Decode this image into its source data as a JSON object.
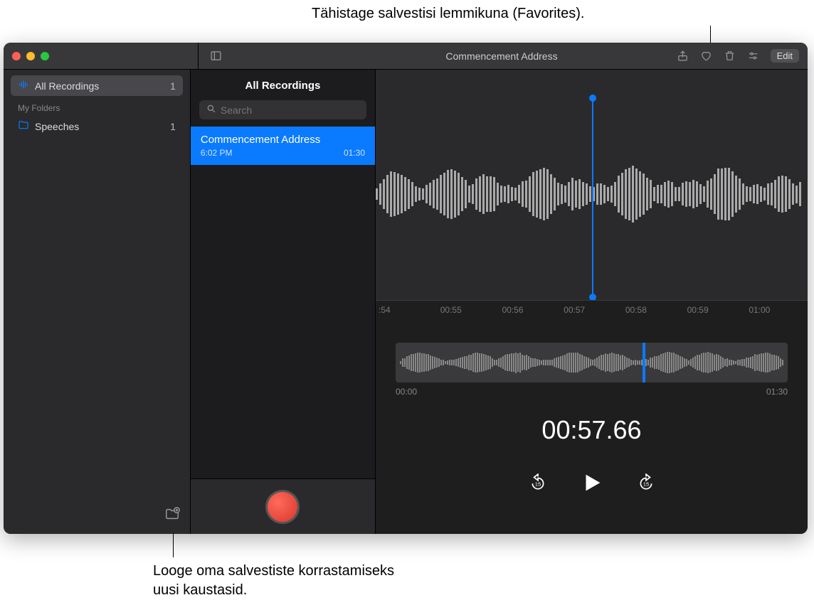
{
  "callouts": {
    "top": "Tähistage salvestisi lemmikuna (Favorites).",
    "bottom": "Looge oma salvestiste korrastamiseks\nuusi kaustasid."
  },
  "titlebar": {
    "title": "Commencement Address",
    "edit": "Edit"
  },
  "sidebar": {
    "all": "All Recordings",
    "allCount": "1",
    "myFolders": "My Folders",
    "folders": [
      {
        "name": "Speeches",
        "count": "1"
      }
    ]
  },
  "list": {
    "title": "All Recordings",
    "searchPlaceholder": "Search",
    "items": [
      {
        "name": "Commencement Address",
        "time": "6:02 PM",
        "dur": "01:30"
      }
    ]
  },
  "detail": {
    "ruler": [
      ":54",
      "00:55",
      "00:56",
      "00:57",
      "00:58",
      "00:59",
      "01:00"
    ],
    "ovStart": "00:00",
    "ovEnd": "01:30",
    "timecode": "00:57.66"
  }
}
